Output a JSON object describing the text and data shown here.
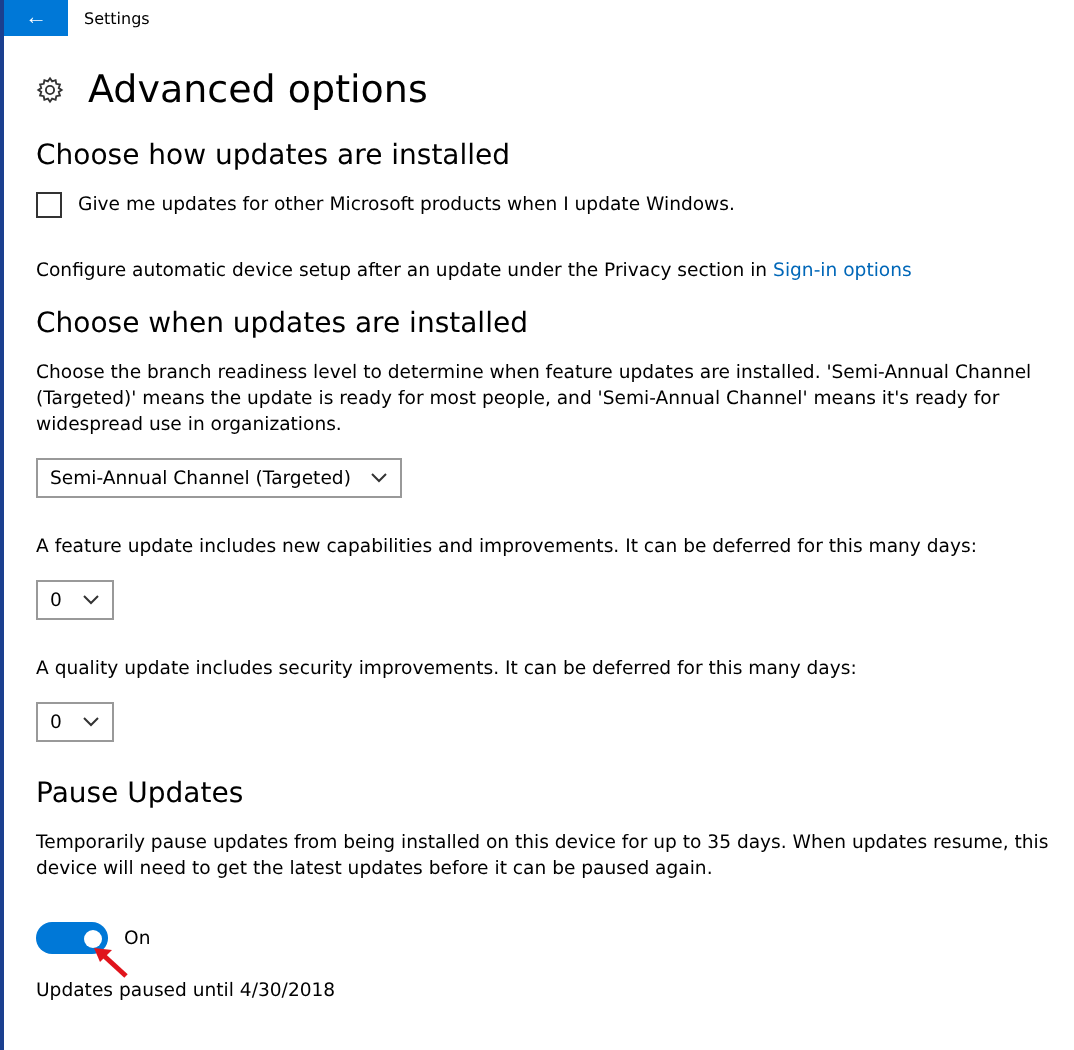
{
  "window": {
    "title": "Settings",
    "back": "←"
  },
  "page_title": "Advanced options",
  "sections": [
    {
      "heading": "Choose how updates are installed",
      "items": [
        {
          "kind": "checkbox",
          "label": "Give me updates for other Microsoft products when I update Windows.",
          "checked": false
        },
        {
          "kind": "text",
          "text": "Configure automatic device setup after an update under the Privacy section in",
          "link": "Sign-in options"
        }
      ]
    },
    {
      "heading": "Choose when updates are installed",
      "items": [
        {
          "kind": "text",
          "text": "Choose the branch readiness level to determine when feature updates are installed. 'Semi-Annual Channel (Targeted)' means the update is ready for most people, and 'Semi-Annual Channel' means it's ready for widespread use in organizations."
        },
        {
          "kind": "dropdown",
          "value": "Semi-Annual Channel (Targeted)"
        },
        {
          "kind": "text",
          "text": "A feature update includes new capabilities and improvements. It can be deferred for this many days:"
        },
        {
          "kind": "dropdown",
          "value": "0"
        },
        {
          "kind": "text",
          "text": "A quality update includes security improvements. It can be deferred for this many days:"
        },
        {
          "kind": "dropdown",
          "value": "0"
        }
      ]
    },
    {
      "heading": "Pause Updates",
      "items": [
        {
          "kind": "text",
          "text": "Temporarily pause updates from being installed on this device for up to 35 days. When updates resume, this device will need to get the latest updates before it can be paused again."
        },
        {
          "kind": "toggle",
          "label": "On",
          "on": true
        },
        {
          "kind": "text",
          "text": "Updates paused until  4/30/2018"
        }
      ]
    }
  ]
}
